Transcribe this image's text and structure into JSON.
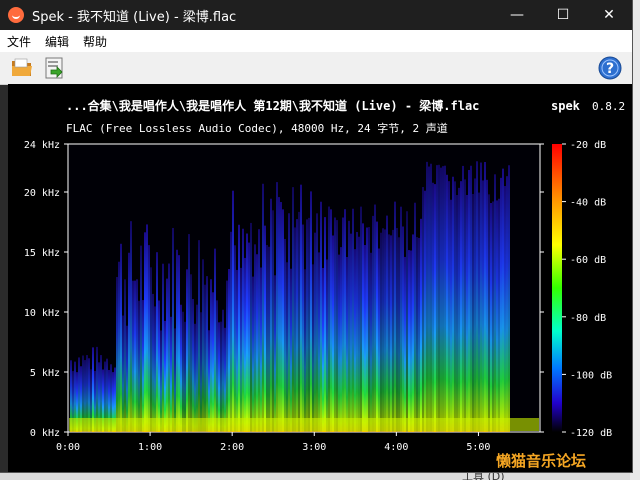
{
  "window": {
    "title": "Spek - 我不知道 (Live) - 梁博.flac",
    "controls": {
      "minimize": "—",
      "maximize": "☐",
      "close": "✕"
    }
  },
  "menu": {
    "items": [
      "文件",
      "编辑",
      "帮助"
    ]
  },
  "toolbar": {
    "open_icon": "folder-open-icon",
    "save_icon": "save-icon",
    "help_icon": "help-icon"
  },
  "spectrogram": {
    "header_title": "...合集\\我是唱作人\\我是唱作人 第12期\\我不知道 (Live) - 梁博.flac",
    "app_label": "spek",
    "version": "0.8.2",
    "info": "FLAC (Free Lossless Audio Codec), 48000 Hz, 24 字节, 2 声道",
    "y_ticks": [
      "0 kHz",
      "5 kHz",
      "10 kHz",
      "15 kHz",
      "20 kHz",
      "24 kHz"
    ],
    "x_ticks": [
      "0:00",
      "1:00",
      "2:00",
      "3:00",
      "4:00",
      "5:00"
    ],
    "db_ticks": [
      "-20 dB",
      "-40 dB",
      "-60 dB",
      "-80 dB",
      "-100 dB",
      "-120 dB"
    ]
  },
  "watermark": "懒猫音乐论坛",
  "desktop": {
    "right_label": "工具 (D)"
  }
}
